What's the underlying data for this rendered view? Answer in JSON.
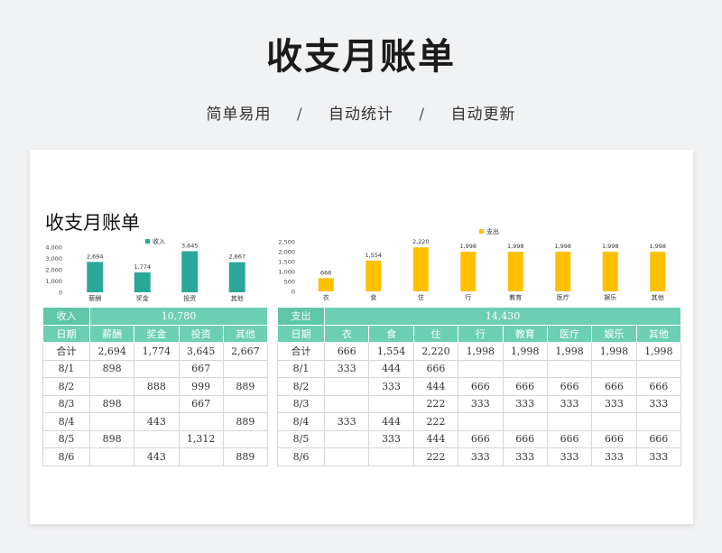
{
  "header": {
    "title": "收支月账单",
    "subtitle_parts": [
      "简单易用",
      "自动统计",
      "自动更新"
    ],
    "separator": "/"
  },
  "sheet_title": "收支月账单",
  "colors": {
    "income_bar": "#2ba79a",
    "expense_bar": "#ffc000",
    "band": "#6ccfb3"
  },
  "chart_data": [
    {
      "type": "bar",
      "legend": "收入",
      "categories": [
        "薪酬",
        "奖金",
        "投资",
        "其他"
      ],
      "values": [
        2694,
        1774,
        3645,
        2667
      ],
      "value_labels": [
        "2,694",
        "1,774",
        "3,645",
        "2,667"
      ],
      "yticks": [
        "4,000",
        "3,000",
        "2,000",
        "1,000",
        "0"
      ],
      "ylim": [
        0,
        4000
      ],
      "legend_position": "top"
    },
    {
      "type": "bar",
      "legend": "支出",
      "categories": [
        "衣",
        "食",
        "住",
        "行",
        "教育",
        "医疗",
        "娱乐",
        "其他"
      ],
      "values": [
        666,
        1554,
        2220,
        1998,
        1998,
        1998,
        1998,
        1998
      ],
      "value_labels": [
        "666",
        "1,554",
        "2,220",
        "1,998",
        "1,998",
        "1,998",
        "1,998",
        "1,998"
      ],
      "yticks": [
        "2,500",
        "2,000",
        "1,500",
        "1,000",
        "500",
        "0"
      ],
      "ylim": [
        0,
        2500
      ],
      "legend_position": "top"
    }
  ],
  "income_table": {
    "band_label": "收入",
    "band_total": "10,780",
    "headers": [
      "日期",
      "薪酬",
      "奖金",
      "投资",
      "其他"
    ],
    "total_row": [
      "合计",
      "2,694",
      "1,774",
      "3,645",
      "2,667"
    ],
    "rows": [
      [
        "8/1",
        "898",
        "",
        "667",
        ""
      ],
      [
        "8/2",
        "",
        "888",
        "999",
        "889"
      ],
      [
        "8/3",
        "898",
        "",
        "667",
        ""
      ],
      [
        "8/4",
        "",
        "443",
        "",
        "889"
      ],
      [
        "8/5",
        "898",
        "",
        "1,312",
        ""
      ],
      [
        "8/6",
        "",
        "443",
        "",
        "889"
      ]
    ]
  },
  "expense_table": {
    "band_label": "支出",
    "band_total": "14,430",
    "headers": [
      "日期",
      "衣",
      "食",
      "住",
      "行",
      "教育",
      "医疗",
      "娱乐",
      "其他"
    ],
    "total_row": [
      "合计",
      "666",
      "1,554",
      "2,220",
      "1,998",
      "1,998",
      "1,998",
      "1,998",
      "1,998"
    ],
    "rows": [
      [
        "8/1",
        "333",
        "444",
        "666",
        "",
        "",
        "",
        "",
        ""
      ],
      [
        "8/2",
        "",
        "333",
        "444",
        "666",
        "666",
        "666",
        "666",
        "666"
      ],
      [
        "8/3",
        "",
        "",
        "222",
        "333",
        "333",
        "333",
        "333",
        "333"
      ],
      [
        "8/4",
        "333",
        "444",
        "222",
        "",
        "",
        "",
        "",
        ""
      ],
      [
        "8/5",
        "",
        "333",
        "444",
        "666",
        "666",
        "666",
        "666",
        "666"
      ],
      [
        "8/6",
        "",
        "",
        "222",
        "333",
        "333",
        "333",
        "333",
        "333"
      ]
    ]
  }
}
